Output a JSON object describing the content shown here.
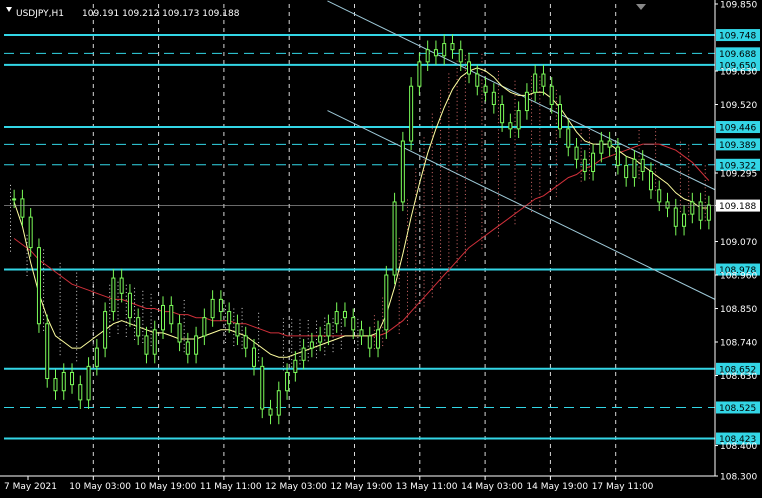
{
  "window": {
    "symbol_tf": "USDJPY,H1",
    "ohlc": "109.191 109.212 109.173 109.188"
  },
  "colors": {
    "background": "#000000",
    "bull_candle": "#7CFC5A",
    "hline": "#33D6E6",
    "grid": "#FFFFFF",
    "ma_fast": "#FFFFA0",
    "ma_slow": "#D0303A",
    "cloud_dots": "#FFFFFF",
    "cloud_dots_red": "#FF8080",
    "channel": "#9EC9D8",
    "axis_text": "#FFFFFF",
    "price_marker_bg": "#FFFFFF"
  },
  "chart_data": {
    "type": "candlestick",
    "symbol": "USDJPY",
    "timeframe": "H1",
    "ylim": [
      108.3,
      109.85
    ],
    "y_ticks": [
      "109.850",
      "109.748",
      "109.688",
      "109.650",
      "109.630",
      "109.520",
      "109.446",
      "109.389",
      "109.322",
      "109.295",
      "109.188",
      "109.070",
      "108.978",
      "108.960",
      "108.850",
      "108.740",
      "108.652",
      "108.630",
      "108.525",
      "108.423",
      "108.400",
      "108.300"
    ],
    "x_ticks": [
      "7 May 2021",
      "10 May 03:00",
      "10 May 19:00",
      "11 May 11:00",
      "12 May 03:00",
      "12 May 19:00",
      "13 May 11:00",
      "14 May 03:00",
      "14 May 19:00",
      "17 May 11:00"
    ],
    "horizontal_lines": [
      {
        "price": 109.748,
        "style": "solid"
      },
      {
        "price": 109.688,
        "style": "dashed"
      },
      {
        "price": 109.65,
        "style": "solid"
      },
      {
        "price": 109.446,
        "style": "solid"
      },
      {
        "price": 109.389,
        "style": "dashed"
      },
      {
        "price": 109.322,
        "style": "dashed"
      },
      {
        "price": 108.978,
        "style": "solid"
      },
      {
        "price": 108.652,
        "style": "solid"
      },
      {
        "price": 108.525,
        "style": "dashed"
      },
      {
        "price": 108.423,
        "style": "solid"
      }
    ],
    "current_price": 109.188,
    "channel": {
      "upper": [
        [
          0.455,
          109.86
        ],
        [
          1.0,
          109.24
        ]
      ],
      "lower": [
        [
          0.455,
          109.5
        ],
        [
          1.0,
          108.88
        ]
      ]
    },
    "closes": [
      109.21,
      109.15,
      109.05,
      108.8,
      108.62,
      108.58,
      108.64,
      108.6,
      108.55,
      108.66,
      108.72,
      108.84,
      108.95,
      108.9,
      108.82,
      108.76,
      108.7,
      108.78,
      108.86,
      108.8,
      108.74,
      108.7,
      108.76,
      108.82,
      108.88,
      108.84,
      108.8,
      108.76,
      108.72,
      108.66,
      108.52,
      108.5,
      108.58,
      108.64,
      108.68,
      108.72,
      108.74,
      108.76,
      108.8,
      108.84,
      108.82,
      108.78,
      108.76,
      108.72,
      108.78,
      108.96,
      109.2,
      109.4,
      109.58,
      109.66,
      109.7,
      109.68,
      109.72,
      109.7,
      109.66,
      109.62,
      109.58,
      109.56,
      109.52,
      109.46,
      109.44,
      109.5,
      109.56,
      109.62,
      109.58,
      109.52,
      109.44,
      109.38,
      109.34,
      109.3,
      109.36,
      109.4,
      109.38,
      109.32,
      109.28,
      109.34,
      109.3,
      109.24,
      109.2,
      109.18,
      109.12,
      109.16,
      109.2,
      109.14,
      109.19
    ],
    "ma_fast": [
      109.2,
      109.12,
      109.0,
      108.9,
      108.82,
      108.76,
      108.74,
      108.72,
      108.72,
      108.74,
      108.76,
      108.78,
      108.8,
      108.81,
      108.8,
      108.79,
      108.78,
      108.77,
      108.77,
      108.76,
      108.75,
      108.75,
      108.75,
      108.76,
      108.77,
      108.78,
      108.78,
      108.77,
      108.76,
      108.74,
      108.72,
      108.7,
      108.69,
      108.69,
      108.7,
      108.71,
      108.72,
      108.73,
      108.74,
      108.75,
      108.76,
      108.76,
      108.76,
      108.76,
      108.77,
      108.83,
      108.92,
      109.03,
      109.15,
      109.26,
      109.36,
      109.44,
      109.51,
      109.57,
      109.61,
      109.63,
      109.64,
      109.63,
      109.61,
      109.58,
      109.56,
      109.55,
      109.55,
      109.56,
      109.56,
      109.54,
      109.51,
      109.47,
      109.43,
      109.4,
      109.39,
      109.39,
      109.39,
      109.37,
      109.35,
      109.34,
      109.32,
      109.3,
      109.28,
      109.26,
      109.23,
      109.21,
      109.2,
      109.18,
      109.18
    ],
    "ma_slow": [
      109.08,
      109.06,
      109.04,
      109.01,
      108.99,
      108.97,
      108.95,
      108.93,
      108.92,
      108.91,
      108.9,
      108.89,
      108.88,
      108.88,
      108.87,
      108.86,
      108.85,
      108.85,
      108.84,
      108.84,
      108.83,
      108.83,
      108.82,
      108.82,
      108.81,
      108.81,
      108.81,
      108.8,
      108.8,
      108.79,
      108.78,
      108.77,
      108.77,
      108.76,
      108.76,
      108.76,
      108.76,
      108.76,
      108.76,
      108.76,
      108.76,
      108.76,
      108.76,
      108.76,
      108.76,
      108.77,
      108.79,
      108.81,
      108.84,
      108.87,
      108.9,
      108.93,
      108.96,
      108.99,
      109.02,
      109.05,
      109.07,
      109.09,
      109.11,
      109.13,
      109.15,
      109.17,
      109.19,
      109.21,
      109.22,
      109.24,
      109.26,
      109.28,
      109.29,
      109.31,
      109.32,
      109.34,
      109.35,
      109.36,
      109.37,
      109.38,
      109.39,
      109.39,
      109.39,
      109.38,
      109.37,
      109.35,
      109.33,
      109.3,
      109.27
    ]
  }
}
